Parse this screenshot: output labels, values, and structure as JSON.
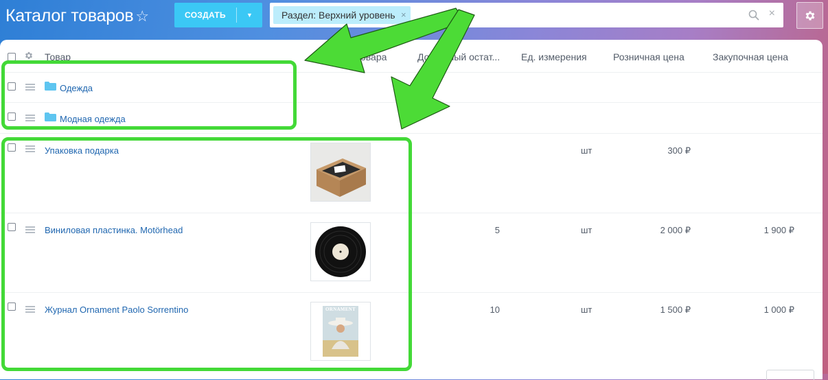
{
  "header": {
    "title": "Каталог товаров",
    "star": "☆",
    "create_label": "СОЗДАТЬ",
    "filter_chip": "Раздел: Верхний уровень",
    "filter_chip_remove": "×",
    "search_clear": "×"
  },
  "columns": [
    "Товар",
    "и товара",
    "Доступный остат...",
    "Ед. измерения",
    "Розничная цена",
    "Закупочная цена"
  ],
  "sections": [
    {
      "name": "Одежда"
    },
    {
      "name": "Модная одежда"
    }
  ],
  "products": [
    {
      "name": "Упаковка подарка",
      "image": "gift-box-image",
      "available": "",
      "unit": "шт",
      "retail": "300 ₽",
      "purchase": ""
    },
    {
      "name": "Виниловая пластинка. Motörhead",
      "image": "vinyl-record-image",
      "available": "5",
      "unit": "шт",
      "retail": "2 000 ₽",
      "purchase": "1 900 ₽"
    },
    {
      "name": "Журнал Ornament Paolo Sorrentino",
      "image": "magazine-cover-image",
      "magazine_title": "ORNAMENT",
      "available": "10",
      "unit": "шт",
      "retail": "1 500 ₽",
      "purchase": "1 000 ₽"
    }
  ],
  "icons": {
    "settings": "gear-icon",
    "search": "search-icon",
    "folder": "folder-icon",
    "drag": "drag-handle-icon"
  },
  "colors": {
    "accent": "#3bc8f5",
    "link": "#2067b0",
    "highlight": "#43d937",
    "folder": "#5ec5f0"
  }
}
